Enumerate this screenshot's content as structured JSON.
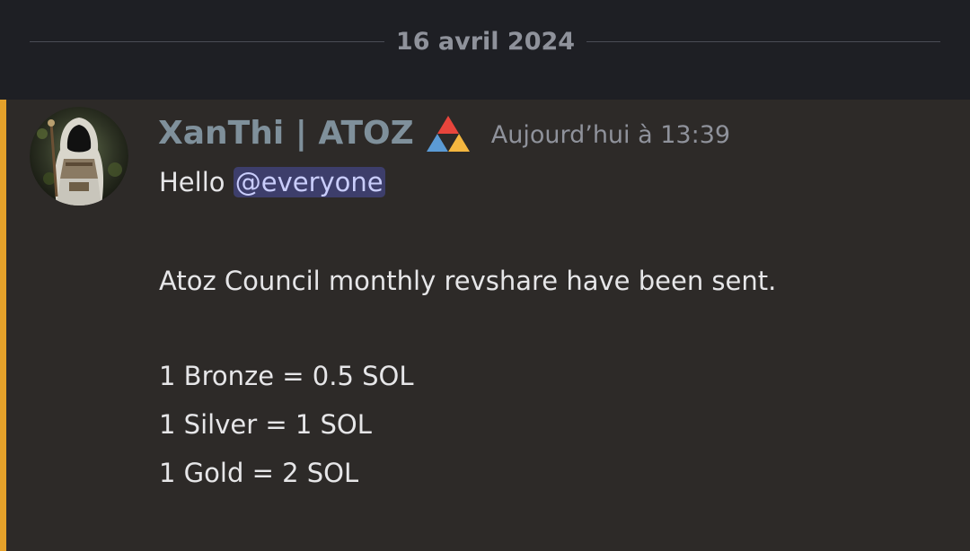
{
  "divider": {
    "date": "16 avril 2024"
  },
  "message": {
    "author": "XanThi | ATOZ",
    "role_icon": "atoz-triangle-icon",
    "timestamp": "Aujourd’hui à 13:39",
    "greeting": "Hello ",
    "mention": "@everyone",
    "body": "Atoz Council monthly revshare have been sent.",
    "rates": [
      "1 Bronze = 0.5 SOL",
      "1 Silver = 1 SOL",
      "1 Gold = 2 SOL"
    ]
  },
  "colors": {
    "mention_bar": "#e5a12a",
    "mention_bg": "#3d3e6b",
    "mention_text": "#c9cdfb",
    "username": "#7f909b",
    "top_background": "#1e1f24",
    "message_background": "#2d2a28"
  }
}
